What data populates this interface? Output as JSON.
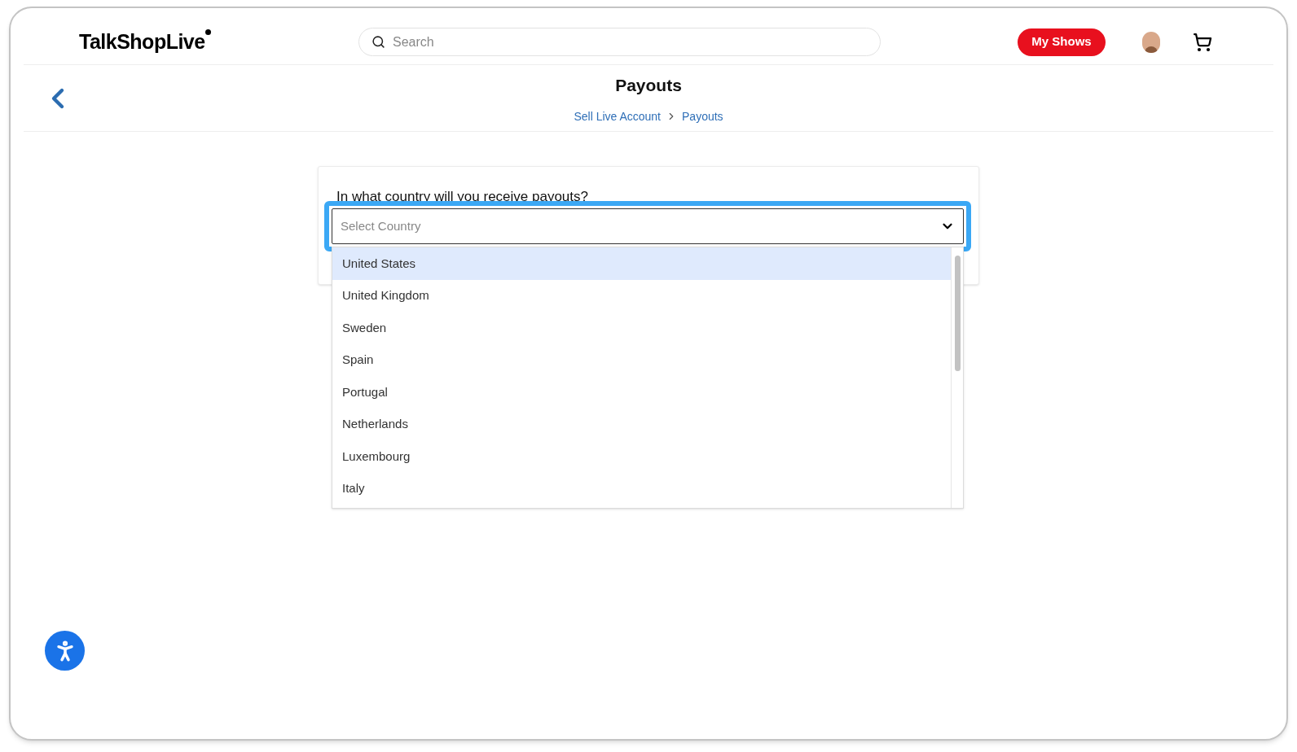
{
  "header": {
    "logo": "TalkShopLive",
    "search": {
      "placeholder": "Search"
    },
    "my_shows_button": "My Shows"
  },
  "page": {
    "title": "Payouts",
    "breadcrumb": [
      "Sell Live Account",
      "Payouts"
    ]
  },
  "form": {
    "question": "In what country will you receive payouts?",
    "select": {
      "placeholder": "Select Country",
      "expanded": true,
      "focused": true
    },
    "options": [
      {
        "label": "United States",
        "selected": true
      },
      {
        "label": "United Kingdom",
        "selected": false
      },
      {
        "label": "Sweden",
        "selected": false
      },
      {
        "label": "Spain",
        "selected": false
      },
      {
        "label": "Portugal",
        "selected": false
      },
      {
        "label": "Netherlands",
        "selected": false
      },
      {
        "label": "Luxembourg",
        "selected": false
      },
      {
        "label": "Italy",
        "selected": false
      }
    ]
  }
}
